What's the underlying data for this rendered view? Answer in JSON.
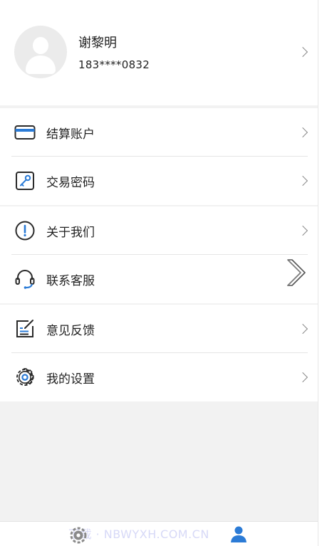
{
  "profile": {
    "name": "谢黎明",
    "phone": "183****0832"
  },
  "menu": {
    "groups": [
      [
        {
          "label": "结算账户",
          "icon": "card-icon"
        },
        {
          "label": "交易密码",
          "icon": "key-icon"
        }
      ],
      [
        {
          "label": "关于我们",
          "icon": "exclamation-circle-icon"
        },
        {
          "label": "联系客服",
          "icon": "headset-icon"
        }
      ],
      [
        {
          "label": "意见反馈",
          "icon": "feedback-edit-icon"
        },
        {
          "label": "我的设置",
          "icon": "gear-icon"
        }
      ]
    ]
  },
  "tabbar": {
    "tabs": [
      {
        "name": "home",
        "icon": "gear-home-icon",
        "active": false
      },
      {
        "name": "me",
        "icon": "person-icon",
        "active": true
      }
    ],
    "watermark": "下载 · NBWYXH.COM.CN"
  },
  "colors": {
    "accent": "#2b7bd6",
    "icon_dark": "#2a2a2a",
    "background": "#f2f2f2"
  }
}
